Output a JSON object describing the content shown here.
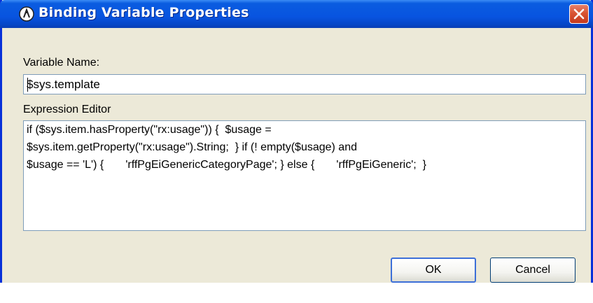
{
  "window": {
    "title": "Binding Variable Properties",
    "icon": "gear-compass-icon",
    "close_icon": "close-icon"
  },
  "variable_name": {
    "label": "Variable Name:",
    "value": "$sys.template"
  },
  "expression": {
    "label": "Expression Editor",
    "value": "if ($sys.item.hasProperty(\"rx:usage\")) {  $usage = \n$sys.item.getProperty(\"rx:usage\").String;  } if (! empty($usage) and \n$usage == 'L') {       'rffPgEiGenericCategoryPage'; } else {       'rffPgEiGeneric';  }"
  },
  "buttons": {
    "ok": "OK",
    "cancel": "Cancel"
  },
  "colors": {
    "titlebar": "#0854e0",
    "frame": "#0831d9",
    "dialog_bg": "#ece9d8",
    "close_button": "#d95332"
  }
}
